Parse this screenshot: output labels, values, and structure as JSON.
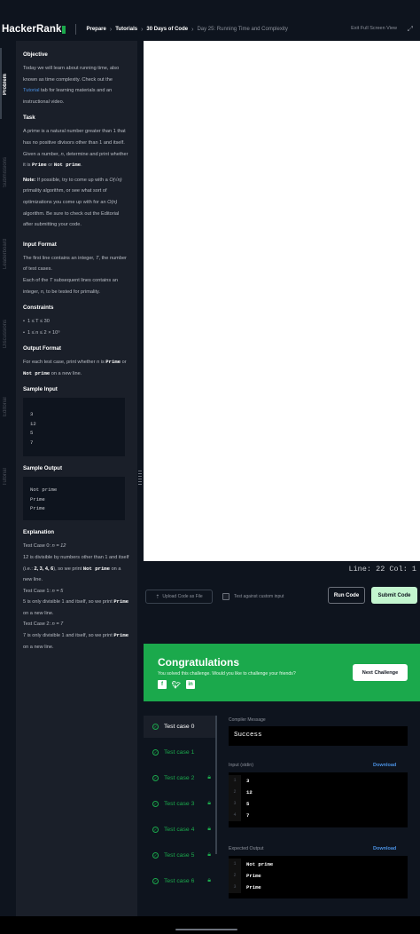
{
  "header": {
    "logo": "HackerRank",
    "breadcrumbs": [
      "Prepare",
      "Tutorials",
      "30 Days of Code",
      "Day 25: Running Time and Complexity"
    ],
    "exit_label": "Exit Full Screen View",
    "expand_icon": "expand-arrows-icon"
  },
  "rail": {
    "tabs": [
      "Problem",
      "Submissions",
      "Leaderboard",
      "Discussions",
      "Editorial",
      "Tutorial"
    ],
    "active": "Problem"
  },
  "problem": {
    "objective_heading": "Objective",
    "objective_text_a": "Today we will learn about running time, also known as time complexity. Check out the ",
    "objective_link": "Tutorial",
    "objective_text_b": " tab for learning materials and an instructional video.",
    "task_heading": "Task",
    "task_a": "A prime is a natural number greater than ",
    "task_one": "1",
    "task_b": " that has no positive divisors other than ",
    "task_c": " and itself. Given a number, ",
    "task_n": "n",
    "task_d": ", determine and print whether it is ",
    "prime": "Prime",
    "or": " or ",
    "not_prime": "Not prime",
    "period": ".",
    "note_label": "Note:",
    "note_a": " If possible, try to come up with a ",
    "note_sqrt": "O(√n)",
    "note_b": " primality algorithm, or see what sort of optimizations you come up with for an ",
    "note_on": "O(n)",
    "note_c": " algorithm. Be sure to check out the Editorial after submitting your code.",
    "input_heading": "Input Format",
    "input_a": "The first line contains an integer, ",
    "input_T": "T",
    "input_b": ", the number of test cases.",
    "input_c": "Each of the ",
    "input_d": " subsequent lines contains an integer, ",
    "input_e": ", to be tested for primality.",
    "constraints_heading": "Constraints",
    "constraints": [
      "1 ≤ T ≤ 30",
      "1 ≤ n ≤ 2 × 10⁹"
    ],
    "output_heading": "Output Format",
    "output_a": "For each test case, print whether ",
    "output_b": " is ",
    "output_c": " on a new line.",
    "sample_input_heading": "Sample Input",
    "sample_input": [
      "3",
      "12",
      "5",
      "7"
    ],
    "sample_output_heading": "Sample Output",
    "sample_output": [
      "Not prime",
      "Prime",
      "Prime"
    ],
    "explanation_heading": "Explanation",
    "tc0_label": "Test Case 0: ",
    "tc0_eq": "n = 12",
    "tc0_a": "12",
    "tc0_b": " is divisible by numbers other than ",
    "tc0_c": " and itself (i.e.: ",
    "tc0_divs": "2, 3, 4, 6",
    "tc0_d": "), so we print ",
    "tc0_e": " on a new line.",
    "tc1_label": "Test Case 1: ",
    "tc1_eq": "n = 5",
    "tc1_a": "5",
    "tc1_b": " is only divisible 1 and itself, so we print ",
    "tc1_c": " on a new line.",
    "tc2_label": "Test Case 2: ",
    "tc2_eq": "n = 7",
    "tc2_a": "7",
    "tc2_b": " is only divisible 1 and itself, so we print ",
    "tc2_c": " on a new line."
  },
  "editor": {
    "line_col": "Line: 22 Col: 1"
  },
  "actions": {
    "upload": "Upload Code as File",
    "custom_input": "Test against custom input",
    "run": "Run Code",
    "submit": "Submit Code"
  },
  "congrats": {
    "title": "Congratulations",
    "subtitle": "You solved this challenge. Would you like to challenge your friends?",
    "next": "Next Challenge",
    "social_icons": [
      "facebook-icon",
      "twitter-icon",
      "linkedin-icon"
    ]
  },
  "results": {
    "test_cases": [
      {
        "label": "Test case 0",
        "locked": false,
        "active": true
      },
      {
        "label": "Test case 1",
        "locked": false,
        "active": false
      },
      {
        "label": "Test case 2",
        "locked": true,
        "active": false
      },
      {
        "label": "Test case 3",
        "locked": true,
        "active": false
      },
      {
        "label": "Test case 4",
        "locked": true,
        "active": false
      },
      {
        "label": "Test case 5",
        "locked": true,
        "active": false
      },
      {
        "label": "Test case 6",
        "locked": true,
        "active": false
      }
    ],
    "compiler_label": "Compiler Message",
    "compiler_message": "Success",
    "input_label": "Input (stdin)",
    "expected_label": "Expected Output",
    "download": "Download",
    "input_lines": [
      "3",
      "12",
      "5",
      "7"
    ],
    "input_numbers": [
      "1",
      "2",
      "3",
      "4"
    ],
    "expected_lines": [
      "Not prime",
      "Prime",
      "Prime"
    ],
    "expected_numbers": [
      "1",
      "2",
      "3"
    ]
  },
  "colors": {
    "brand_green": "#1ba94c",
    "link_blue": "#4a90e2",
    "background": "#0e141e"
  }
}
